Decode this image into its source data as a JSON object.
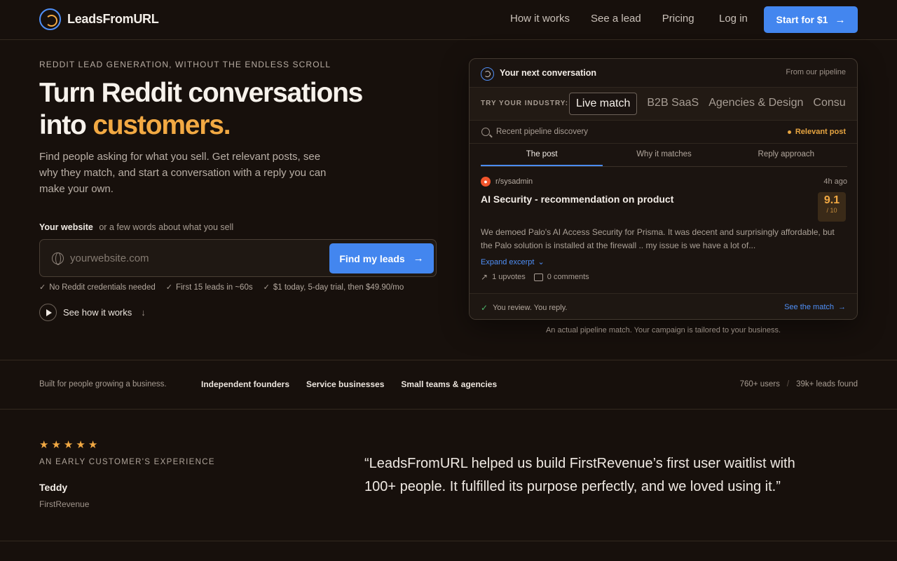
{
  "nav": {
    "brand": "LeadsFromURL",
    "links": [
      "How it works",
      "See a lead",
      "Pricing"
    ],
    "login": "Log in",
    "cta": "Start for $1"
  },
  "hero": {
    "eyebrow": "REDDIT LEAD GENERATION, WITHOUT THE ENDLESS SCROLL",
    "headline_part1": "Turn Reddit conversations",
    "headline_part2": "into ",
    "headline_accent": "customers.",
    "subhead": "Find people asking for what you sell. Get relevant posts, see why they match, and start a conversation with a reply you can make your own.",
    "input_label": "Your website",
    "input_hint": "or a few words about what you sell",
    "input_placeholder": "yourwebsite.com",
    "find_button": "Find my leads",
    "checks": [
      "No Reddit credentials needed",
      "First 15 leads in ~60s",
      "$1 today, 5-day trial, then $49.90/mo"
    ],
    "see_how": "See how it works"
  },
  "card": {
    "title": "Your next conversation",
    "source": "From our pipeline",
    "industry_label": "TRY YOUR INDUSTRY:",
    "industries": [
      "Live match",
      "B2B SaaS",
      "Agencies & Design",
      "Consu"
    ],
    "discovery": "Recent pipeline discovery",
    "relevant": "Relevant post",
    "post_tabs": [
      "The post",
      "Why it matches",
      "Reply approach"
    ],
    "post": {
      "subreddit": "r/sysadmin",
      "time": "4h ago",
      "title": "AI Security - recommendation on product",
      "score": "9.1",
      "score_max": "/ 10",
      "excerpt": "We demoed Palo's AI Access Security for Prisma. It was decent and surprisingly affordable, but the Palo solution is installed at the firewall .. my issue is we have a lot of...",
      "expand": "Expand excerpt",
      "upvotes": "1 upvotes",
      "comments": "0 comments"
    },
    "footer_left": "You review. You reply.",
    "footer_right": "See the match",
    "caption": "An actual pipeline match. Your campaign is tailored to your business."
  },
  "built": {
    "label": "Built for people growing a business.",
    "audiences": [
      "Independent founders",
      "Service businesses",
      "Small teams & agencies"
    ],
    "users": "760+ users",
    "separator": "/",
    "leads": "39k+ leads found"
  },
  "testimonial": {
    "rating": 5,
    "eyebrow": "AN EARLY CUSTOMER'S EXPERIENCE",
    "name": "Teddy",
    "org": "FirstRevenue",
    "quote": "“LeadsFromURL helped us build FirstRevenue’s first user waitlist with 100+ people. It fulfilled its purpose perfectly, and we loved using it.”"
  },
  "colors": {
    "background": "#17100c",
    "accent_orange": "#f2a943",
    "accent_blue": "#4386ef"
  }
}
